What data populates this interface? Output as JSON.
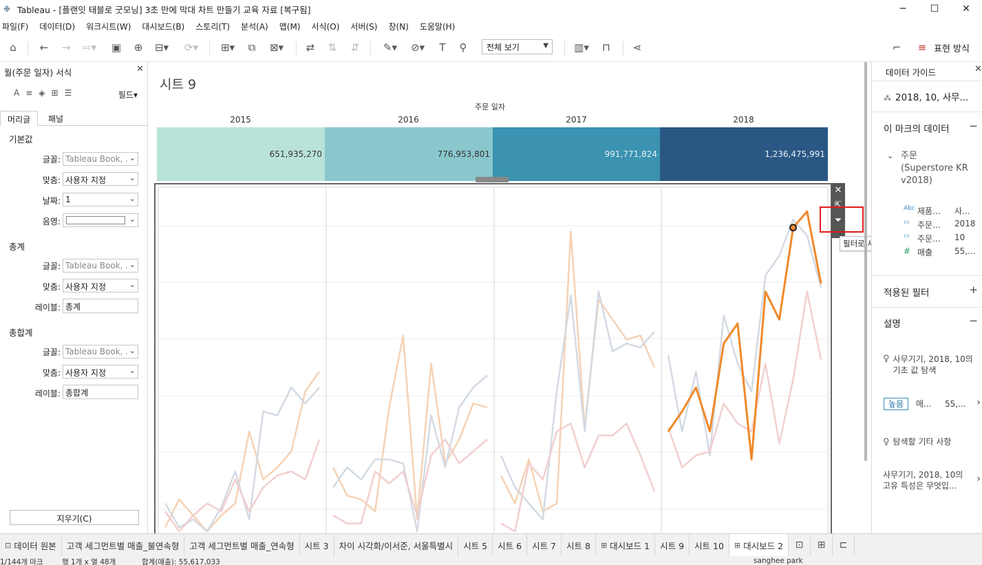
{
  "window": {
    "title": "Tableau - [플랜잇 태블로 굿모닝] 3초 만에 막대 차트 만들기 교육 자료 [복구됨]",
    "minimize": "─",
    "maximize": "☐",
    "close": "✕"
  },
  "menu": [
    "파일(F)",
    "데이터(D)",
    "워크시트(W)",
    "대시보드(B)",
    "스토리(T)",
    "분석(A)",
    "맵(M)",
    "서식(O)",
    "서버(S)",
    "창(N)",
    "도움말(H)"
  ],
  "toolbar": {
    "view_select": "전체 보기",
    "show_me_label": "표현 방식"
  },
  "left_panel": {
    "title": "월(주문 일자) 서식",
    "fields_btn": "필드",
    "tabs": [
      "머리글",
      "패널"
    ],
    "sections": [
      {
        "title": "기본값",
        "rows": [
          {
            "label": "글꼴:",
            "value": "Tableau Book, ..."
          },
          {
            "label": "맞춤:",
            "value": "사용자 지정"
          },
          {
            "label": "날짜:",
            "value": "1"
          },
          {
            "label": "음영:",
            "value": ""
          }
        ]
      },
      {
        "title": "총계",
        "rows": [
          {
            "label": "글꼴:",
            "value": "Tableau Book, ..."
          },
          {
            "label": "맞춤:",
            "value": "사용자 지정"
          },
          {
            "label": "레이블:",
            "value": "총계"
          }
        ]
      },
      {
        "title": "총합계",
        "rows": [
          {
            "label": "글꼴:",
            "value": "Tableau Book, ..."
          },
          {
            "label": "맞춤:",
            "value": "사용자 지정"
          },
          {
            "label": "레이블:",
            "value": "총합계"
          }
        ]
      }
    ],
    "clear_btn": "지우기(C)"
  },
  "canvas": {
    "sheet_title": "시트 9",
    "header_caption": "주문 일자",
    "years": [
      "2015",
      "2016",
      "2017",
      "2018"
    ],
    "bar_values": [
      "651,935,270",
      "776,953,801",
      "991,771,824",
      "1,236,475,991"
    ],
    "bar_colors": [
      "#b9e3d9",
      "#89c7cd",
      "#3b92b1",
      "#2b5784"
    ],
    "bar_text_colors": [
      "#333333",
      "#333333",
      "#e8f2f7",
      "#e8f2f7"
    ],
    "tooltip": "필터로 사용"
  },
  "chart_data": {
    "type": "line",
    "panels": [
      "2015",
      "2016",
      "2017",
      "2018"
    ],
    "x": [
      "1",
      "2",
      "3",
      "4",
      "5",
      "6",
      "7",
      "8",
      "9",
      "10",
      "11",
      "12"
    ],
    "highlight_color": "#f0892a",
    "series": [
      {
        "color": "#f5d2b4",
        "values": [
          0.1,
          0.45,
          0.25,
          0.05,
          0.25,
          0.4,
          1.3,
          0.7,
          0.85,
          1.05,
          1.8,
          2.05
        ]
      },
      {
        "color": "#d3dae3",
        "values": [
          0.4,
          0.1,
          0.2,
          0.05,
          0.35,
          0.8,
          0.2,
          1.55,
          1.5,
          1.85,
          1.65,
          1.85
        ]
      },
      {
        "color": "#f1cfcf",
        "values": [
          0.3,
          0.05,
          0.25,
          0.4,
          0.3,
          0.7,
          0.3,
          0.6,
          0.75,
          0.8,
          0.7,
          1.2
        ]
      },
      {
        "color": "#f5d2b4",
        "values": [
          0.85,
          0.5,
          0.45,
          0.3,
          1.6,
          2.5,
          0.2,
          2.15,
          0.9,
          1.2,
          1.65,
          1.6
        ]
      },
      {
        "color": "#d3dae3",
        "values": [
          0.6,
          0.85,
          0.7,
          0.95,
          0.95,
          0.9,
          0.05,
          1.5,
          0.85,
          1.6,
          1.85,
          2.0
        ]
      },
      {
        "color": "#f1cfcf",
        "values": [
          0.25,
          0.15,
          0.15,
          0.8,
          0.65,
          0.8,
          0.25,
          1.0,
          1.2,
          0.9,
          1.05,
          1.2
        ]
      },
      {
        "color": "#f5d2b4",
        "values": [
          0.75,
          0.4,
          0.95,
          0.3,
          0.4,
          3.8,
          1.35,
          2.95,
          2.7,
          2.45,
          2.5,
          2.1
        ]
      },
      {
        "color": "#d3dae3",
        "values": [
          1.0,
          0.6,
          0.4,
          0.2,
          1.8,
          3.0,
          1.3,
          3.05,
          2.3,
          2.4,
          2.35,
          2.55
        ]
      },
      {
        "color": "#f1cfcf",
        "values": [
          0.15,
          0.05,
          0.9,
          0.7,
          1.3,
          1.4,
          0.85,
          1.25,
          1.25,
          1.4,
          1.0,
          0.55
        ]
      },
      {
        "color": "#d3dae3",
        "values": [
          2.25,
          1.3,
          2.05,
          1.0,
          2.75,
          2.15,
          1.8,
          3.25,
          3.5,
          3.95,
          3.75,
          3.1
        ]
      },
      {
        "color": "#f1cfcf",
        "values": [
          1.35,
          0.85,
          1.0,
          1.05,
          1.65,
          1.4,
          1.3,
          2.15,
          1.15,
          1.95,
          3.05,
          2.2
        ]
      },
      {
        "color": "#f0892a",
        "highlight": true,
        "values": [
          1.3,
          1.55,
          1.85,
          1.3,
          2.4,
          2.65,
          0.95,
          3.05,
          2.7,
          3.85,
          4.05,
          3.15
        ]
      }
    ],
    "series_panel": [
      0,
      0,
      0,
      1,
      1,
      1,
      2,
      2,
      2,
      3,
      3,
      3
    ],
    "selected_point": {
      "panel": "2018",
      "x": "10",
      "value": 3.85
    },
    "ylim": [
      0,
      4.2
    ],
    "grid": true
  },
  "right_panel": {
    "title": "데이터 가이드",
    "mark_label": "2018, 10, 사무...",
    "mark_data_title": "이 마크의 데이터",
    "orders_label": "주문\n(Superstore KR\nv2018)",
    "fields": [
      {
        "icon": "Abc",
        "name": "제품...",
        "value": "사..."
      },
      {
        "icon": "cal",
        "name": "주문...",
        "value": "2018"
      },
      {
        "icon": "cal",
        "name": "주문...",
        "value": "10"
      },
      {
        "icon": "#",
        "name": "매출",
        "value": "55,..."
      }
    ],
    "filters_title": "적용된 필터",
    "desc_title": "설명",
    "insight1": "사무기기, 2018, 10의\n기초 값 탐색",
    "badge": "높음",
    "badge_field": "매...",
    "badge_value": "55,...",
    "explore_more": "탐색할 기타 사항",
    "insight2": "사무기기, 2018, 10의\n고유 특성은 무엇입..."
  },
  "bottom_tabs": [
    {
      "label": "데이터 원본",
      "icon": "⊡"
    },
    {
      "label": "고객 세그먼트별 매출_불연속형"
    },
    {
      "label": "고객 세그먼트별 매출_연속형"
    },
    {
      "label": "시트 3"
    },
    {
      "label": "차이 시각화/이서준, 서울특별시"
    },
    {
      "label": "시트 5"
    },
    {
      "label": "시트 6"
    },
    {
      "label": "시트 7"
    },
    {
      "label": "시트 8"
    },
    {
      "label": "대시보드 1",
      "icon": "⊞"
    },
    {
      "label": "시트 9"
    },
    {
      "label": "시트 10"
    },
    {
      "label": "대시보드 2",
      "icon": "⊞",
      "active": true
    }
  ],
  "status": {
    "marks": "1/144개 마크",
    "rowcol": "행 1개 x 열 48개",
    "sum": "합계(매출): 55,617,033",
    "user": "sanghee park"
  }
}
